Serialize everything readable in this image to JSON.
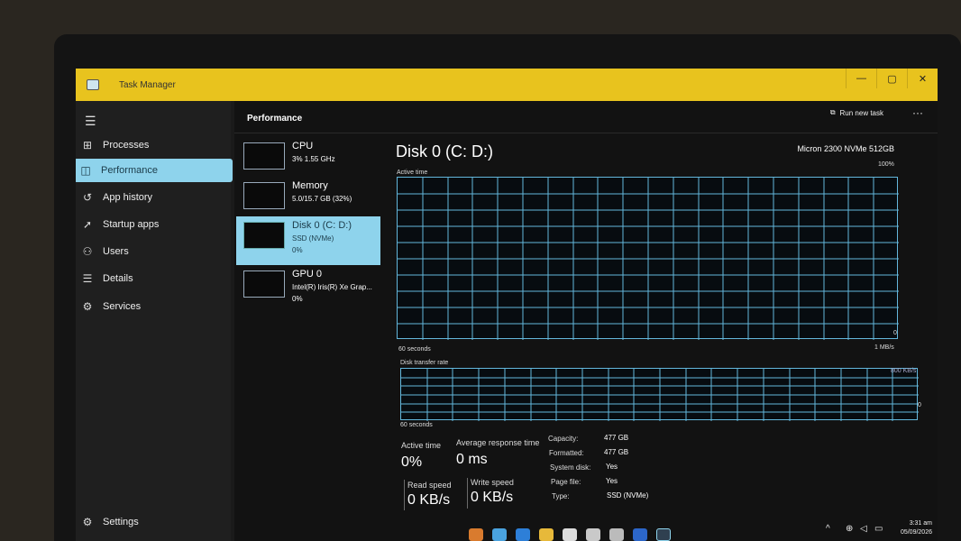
{
  "window": {
    "title": "Task Manager"
  },
  "titlebar": {
    "min": "—",
    "max": "▢",
    "close": "✕"
  },
  "sidebar": {
    "items": [
      {
        "label": "Processes",
        "icon": "processes-icon",
        "glyph": "⊞"
      },
      {
        "label": "Performance",
        "icon": "performance-icon",
        "glyph": "◫"
      },
      {
        "label": "App history",
        "icon": "history-icon",
        "glyph": "↺"
      },
      {
        "label": "Startup apps",
        "icon": "startup-icon",
        "glyph": "➚"
      },
      {
        "label": "Users",
        "icon": "users-icon",
        "glyph": "⚇"
      },
      {
        "label": "Details",
        "icon": "details-icon",
        "glyph": "☰"
      },
      {
        "label": "Services",
        "icon": "services-icon",
        "glyph": "⚙"
      }
    ],
    "settings": {
      "label": "Settings",
      "glyph": "⚙"
    }
  },
  "header": {
    "title": "Performance",
    "run_task": "Run new task",
    "more": "···"
  },
  "devices": [
    {
      "name": "CPU",
      "sub": "3%  1.55 GHz",
      "value": ""
    },
    {
      "name": "Memory",
      "sub": "5.0/15.7 GB (32%)",
      "value": ""
    },
    {
      "name": "Disk 0 (C: D:)",
      "sub": "SSD (NVMe)",
      "value": "0%"
    },
    {
      "name": "GPU 0",
      "sub": "Intel(R) Iris(R) Xe Grap...",
      "value": "0%"
    }
  ],
  "detail": {
    "title": "Disk 0 (C: D:)",
    "model": "Micron 2300 NVMe 512GB",
    "active_time_label": "Active time",
    "active_max": "100%",
    "active_min": "0",
    "active_span": "60 seconds",
    "transfer_max": "1 MB/s",
    "transfer_label": "Disk transfer rate",
    "transfer_mark": "800 KB/s",
    "transfer_min": "0",
    "transfer_span": "60 seconds",
    "stats": {
      "active_time_label": "Active time",
      "active_time": "0%",
      "response_label": "Average response time",
      "response": "0 ms",
      "read_label": "Read speed",
      "read": "0 KB/s",
      "write_label": "Write speed",
      "write": "0 KB/s"
    },
    "info": [
      {
        "label": "Capacity:",
        "value": "477 GB"
      },
      {
        "label": "Formatted:",
        "value": "477 GB"
      },
      {
        "label": "System disk:",
        "value": "Yes"
      },
      {
        "label": "Page file:",
        "value": "Yes"
      },
      {
        "label": "Type:",
        "value": "SSD (NVMe)"
      }
    ]
  },
  "taskbar": {
    "time": "3:31 am",
    "date": "05/09/2026",
    "tray_up": "^"
  },
  "colors": {
    "titlebar": "#e8c31e",
    "accent": "#8ed3ec",
    "graph_line": "#63b7dc"
  }
}
